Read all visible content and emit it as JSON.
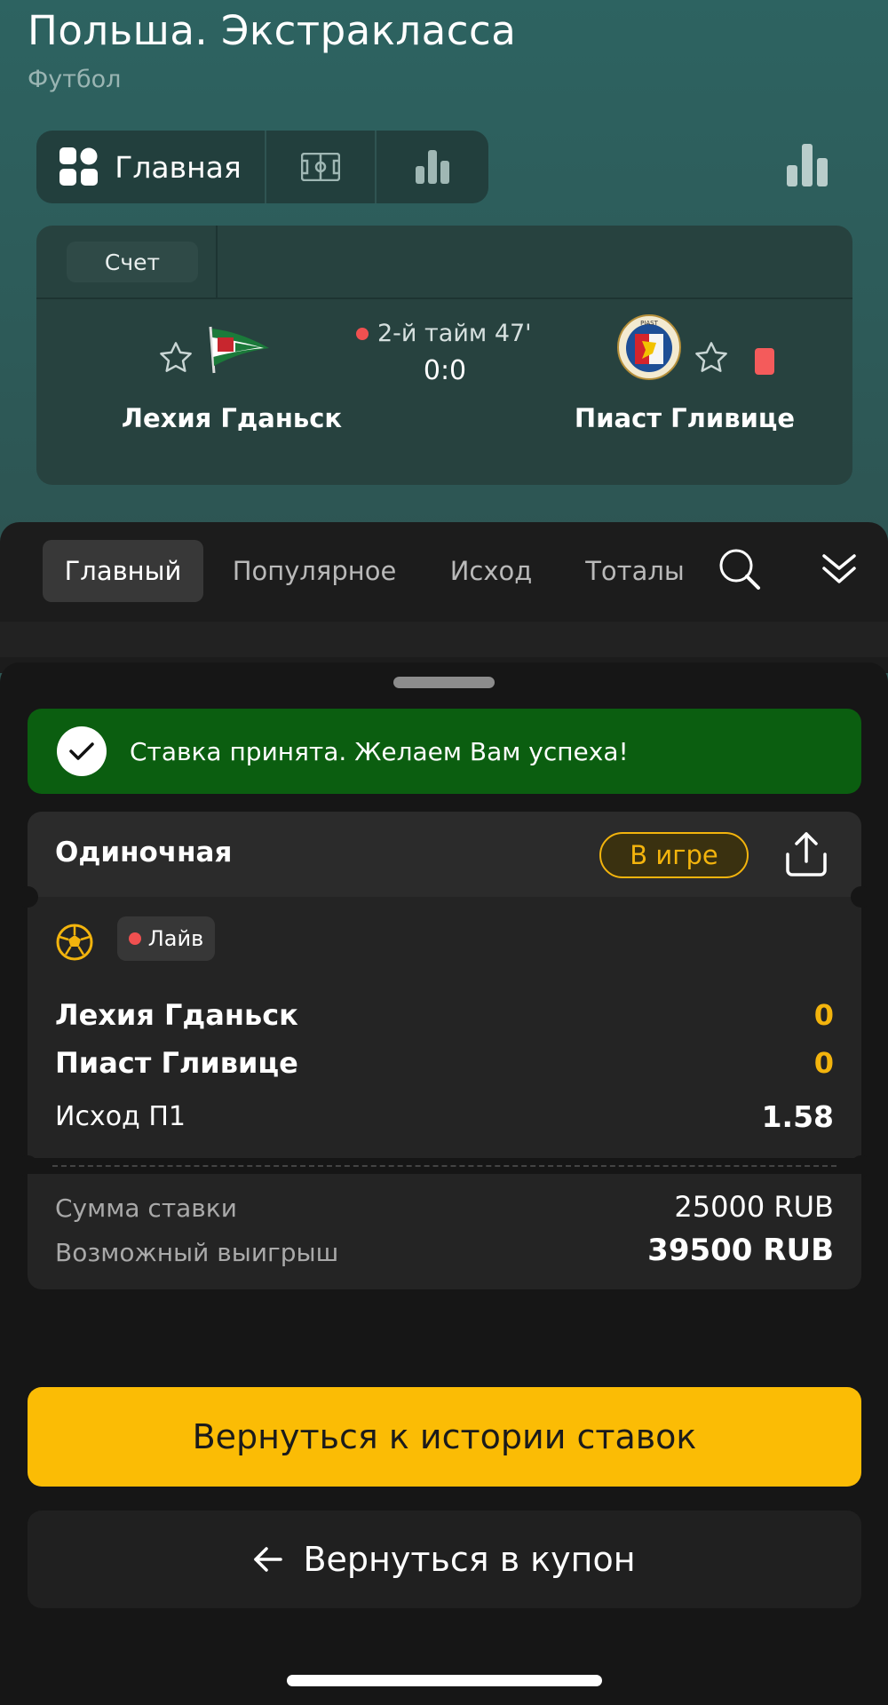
{
  "header": {
    "league": "Польша. Экстракласса",
    "sport": "Футбол"
  },
  "segments": {
    "main_label": "Главная"
  },
  "score_card": {
    "tab_label": "Счет",
    "period": "2-й тайм 47'",
    "score": "0:0",
    "home_team": "Лехия Гданьск",
    "away_team": "Пиаст Гливице"
  },
  "market_tabs": [
    {
      "label": "Главный"
    },
    {
      "label": "Популярное"
    },
    {
      "label": "Исход"
    },
    {
      "label": "Тоталы"
    }
  ],
  "banner": {
    "text": "Ставка принята. Желаем Вам успеха!"
  },
  "bet": {
    "type": "Одиночная",
    "status": "В игре",
    "live_label": "Лайв",
    "home_team": "Лехия Гданьск",
    "home_score": "0",
    "away_team": "Пиаст Гливице",
    "away_score": "0",
    "outcome": "Исход П1",
    "odds": "1.58",
    "stake_label": "Сумма ставки",
    "stake_value": "25000 RUB",
    "win_label": "Возможный выигрыш",
    "win_value": "39500 RUB"
  },
  "buttons": {
    "history": "Вернуться к истории ставок",
    "coupon": "Вернуться в купон"
  },
  "colors": {
    "accent": "#fbbc05",
    "success": "#0b5e10",
    "live": "#f05050"
  }
}
